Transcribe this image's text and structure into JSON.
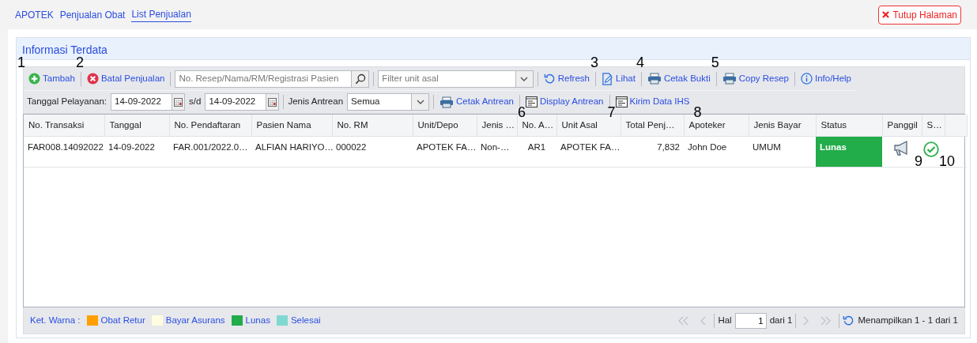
{
  "breadcrumb": [
    {
      "label": "APOTEK",
      "selected": false
    },
    {
      "label": "Penjualan Obat",
      "selected": false
    },
    {
      "label": "List Penjualan",
      "selected": true
    }
  ],
  "close_button": {
    "label": "Tutup Halaman"
  },
  "panel": {
    "title": "Informasi Terdata"
  },
  "toolbar": [
    [
      {
        "kind": "button",
        "label": "Tambah",
        "callout": "1"
      },
      {
        "kind": "button",
        "label": "Batal Penjualan",
        "callout": "2"
      },
      {
        "kind": "search",
        "placeholder": "No. Resep/Nama/RM/Registrasi Pasien"
      },
      {
        "kind": "select",
        "placeholder": "Filter unit asal"
      },
      {
        "kind": "button",
        "label": "Refresh"
      },
      {
        "kind": "button",
        "label": "Lihat",
        "callout": "3"
      },
      {
        "kind": "button",
        "label": "Cetak Bukti",
        "callout": "4"
      },
      {
        "kind": "button",
        "label": "Copy Resep",
        "callout": "5"
      },
      {
        "kind": "button",
        "label": "Info/Help"
      }
    ],
    [
      {
        "kind": "label",
        "label": "Tanggal Pelayanan:"
      },
      {
        "kind": "date",
        "value": "14-09-2022"
      },
      {
        "kind": "label",
        "label": "s/d"
      },
      {
        "kind": "date",
        "value": "14-09-2022"
      },
      {
        "kind": "label",
        "label": "Jenis Antrean"
      },
      {
        "kind": "select",
        "value": "Semua"
      },
      {
        "kind": "button",
        "label": "Cetak Antrean",
        "callout": "6"
      },
      {
        "kind": "button",
        "label": "Display Antrean",
        "callout": "7"
      },
      {
        "kind": "button",
        "label": "Kirim Data IHS",
        "callout": "8"
      }
    ]
  ],
  "table": {
    "columns": [
      "No. Transaksi",
      "Tanggal",
      "No. Pendaftaran",
      "Pasien Nama",
      "No. RM",
      "Unit/Depo",
      "Jenis …",
      "No. A…",
      "Unit Asal",
      "Total Penj…",
      "Apoteker",
      "Jenis Bayar",
      "Status",
      "Panggil",
      "S…"
    ],
    "rows": [
      {
        "cells": [
          "FAR008.14092022",
          "14-09-2022",
          "FAR.001/2022.0…",
          "ALFIAN HARIYO…",
          "000022",
          "APOTEK FA…",
          "Non-…",
          "AR1",
          "APOTEK FA…",
          "7,832",
          "John Doe",
          "UMUM"
        ],
        "status": {
          "label": "Lunas",
          "color": "#22ac4a"
        },
        "call_callout": "9",
        "done": true,
        "done_callout": "10"
      }
    ]
  },
  "legend": {
    "label": "Ket. Warna :",
    "items": [
      {
        "label": "Obat Retur",
        "color": "#ffa000"
      },
      {
        "label": "Bayar Asurans",
        "color": "#fffde0"
      },
      {
        "label": "Lunas",
        "color": "#22ac4a"
      },
      {
        "label": "Selesai",
        "color": "#80d8d0"
      }
    ]
  },
  "pager": {
    "first_disabled": true,
    "prev_disabled": true,
    "page_label": "Hal",
    "page": "1",
    "of": "dari 1",
    "next_disabled": true,
    "last_disabled": true,
    "info": "Menampilkan 1 - 1 dari 1"
  }
}
